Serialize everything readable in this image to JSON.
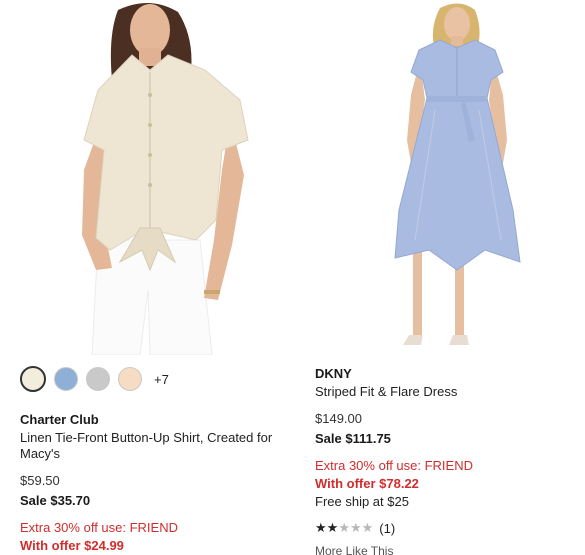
{
  "products": [
    {
      "brand": "Charter Club",
      "name": "Linen Tie-Front Button-Up Shirt, Created for Macy's",
      "original_price": "$59.50",
      "sale_price": "Sale $35.70",
      "promo": "Extra 30% off use: FRIEND",
      "offer_price": "With offer $24.99",
      "swatches": [
        {
          "color": "#f3eddd",
          "selected": true
        },
        {
          "color": "#8eb0d6",
          "selected": false
        },
        {
          "color": "#c9c9c9",
          "selected": false
        },
        {
          "color": "#f6dcc2",
          "selected": false
        }
      ],
      "more_colors": "+7"
    },
    {
      "brand": "DKNY",
      "name": "Striped Fit & Flare Dress",
      "original_price": "$149.00",
      "sale_price": "Sale $111.75",
      "promo": "Extra 30% off use: FRIEND",
      "offer_price": "With offer $78.22",
      "shipping": "Free ship at $25",
      "rating_stars": 2,
      "rating_max": 5,
      "review_count": "(1)",
      "more_like": "More Like This"
    }
  ],
  "colors": {
    "promo_red": "#d12d2d",
    "shirt": "#eee5d2",
    "dress": "#a9bbe0",
    "skin": "#e4b797"
  }
}
